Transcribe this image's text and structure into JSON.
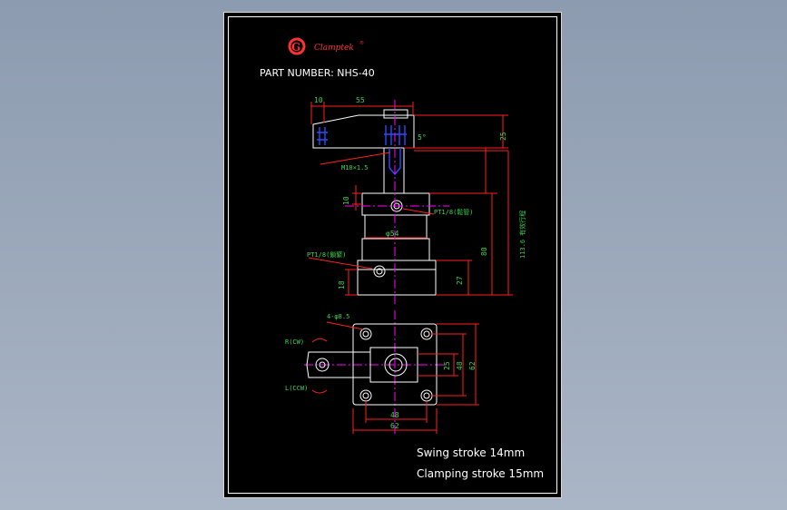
{
  "logo": {
    "initial": "G",
    "brand": "Clamptek",
    "mark": "®"
  },
  "part_number": "PART NUMBER: NHS-40",
  "dimensions": {
    "d10_top": "10",
    "d55": "55",
    "angle5": "5°",
    "d25_right": "25",
    "thread": "M10×1.5",
    "d10_left": "10",
    "port1": "PT1/8(鬆管)",
    "d113": "113.6 有效行程",
    "dia54": "φ54",
    "d80": "80",
    "port2": "PT1/8(鎖緊)",
    "d18": "18",
    "d27": "27",
    "holes": "4-φ8.5",
    "r_cw": "R(CW)",
    "l_ccw": "L(CCW)",
    "d25_plan": "25",
    "d48_v": "48",
    "d62_v": "62",
    "d48_h": "48",
    "d62_h": "62"
  },
  "notes": {
    "swing": "Swing stroke 14mm",
    "clamping": "Clamping stroke 15mm"
  },
  "colors": {
    "background": "#9aa7ba",
    "sheet": "#000000",
    "outline": "#ffffff",
    "dimension": "#ff2020",
    "dim_text": "#39d64a",
    "centerline": "#ff00ff",
    "hidden": "#2b4cff",
    "logo": "#ff3030"
  }
}
